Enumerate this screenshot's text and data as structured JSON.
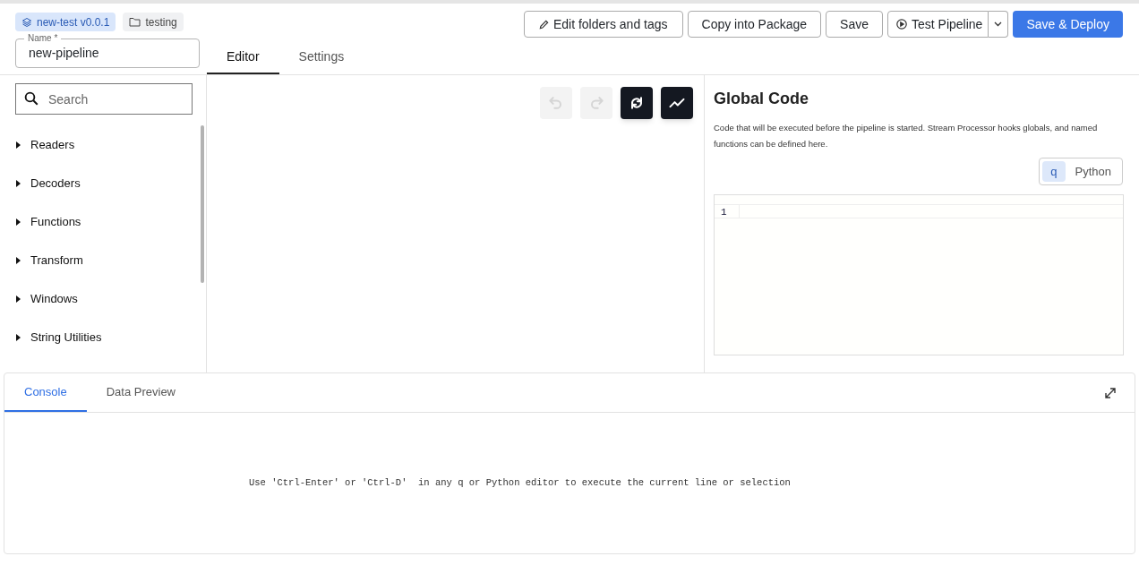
{
  "header": {
    "package_chip": "new-test v0.0.1",
    "folder_chip": "testing",
    "name_field": {
      "label": "Name *",
      "value": "new-pipeline"
    },
    "actions": [
      {
        "label": "Edit folders and tags",
        "kind": "edit"
      },
      {
        "label": "Copy into Package",
        "kind": "plain"
      },
      {
        "label": "Save",
        "kind": "plain"
      },
      {
        "label": "Test Pipeline",
        "kind": "split"
      },
      {
        "label": "Save & Deploy",
        "kind": "primary"
      }
    ]
  },
  "tabs": [
    {
      "label": "Editor",
      "selected": true
    },
    {
      "label": "Settings",
      "selected": false
    }
  ],
  "sidebar": {
    "search": {
      "placeholder": "Search"
    },
    "items": [
      {
        "label": "Readers"
      },
      {
        "label": "Decoders"
      },
      {
        "label": "Functions"
      },
      {
        "label": "Transform"
      },
      {
        "label": "Windows"
      },
      {
        "label": "String Utilities"
      }
    ]
  },
  "canvas_toolbar": [
    {
      "kind": "undo",
      "disabled": true
    },
    {
      "kind": "redo",
      "disabled": true
    },
    {
      "kind": "refresh",
      "disabled": false
    },
    {
      "kind": "chart",
      "disabled": false
    }
  ],
  "global_code": {
    "title": "Global Code",
    "description": "Code that will be executed before the pipeline is started. Stream Processor hooks globals, and named functions can be defined here.",
    "languages": [
      {
        "label": "q",
        "selected": true
      },
      {
        "label": "Python",
        "selected": false
      }
    ],
    "line_numbers": [
      "1"
    ]
  },
  "console": {
    "tabs": [
      {
        "label": "Console",
        "selected": true
      },
      {
        "label": "Data Preview",
        "selected": false
      }
    ],
    "message": "Use 'Ctrl-Enter' or 'Ctrl-D'  in any q or Python editor to execute the current line or selection"
  }
}
